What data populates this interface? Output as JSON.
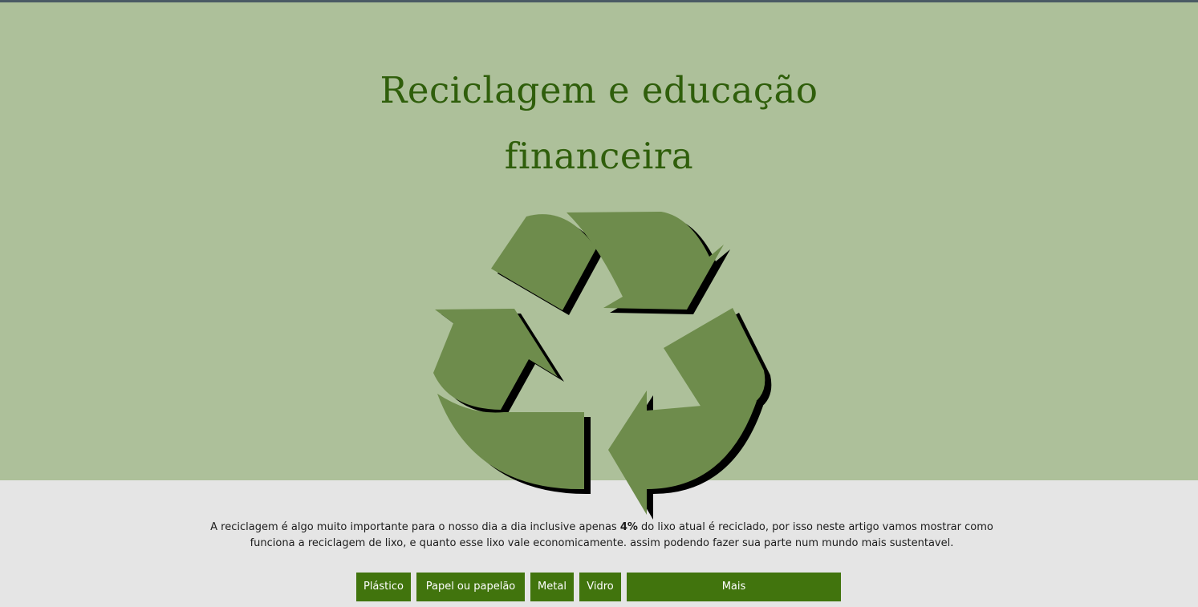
{
  "header": {
    "title_line1": "Reciclagem e educação",
    "title_line2": "financeira"
  },
  "logo": {
    "icon": "recycle-icon",
    "color": "#6e8c4c",
    "shadow": "#000000"
  },
  "intro": {
    "before": "A reciclagem é algo muito importante para o nosso dia a dia inclusive apenas ",
    "highlight": "4%",
    "after": " do lixo atual é reciclado, por isso neste artigo vamos mostrar como funciona a reciclagem de lixo, e quanto esse lixo vale economicamente. assim podendo fazer sua parte num mundo mais sustentavel."
  },
  "menu": {
    "items": [
      {
        "label": "Plástico"
      },
      {
        "label": "Papel ou papelão"
      },
      {
        "label": "Metal"
      },
      {
        "label": "Vidro"
      },
      {
        "label": "Mais"
      }
    ]
  },
  "colors": {
    "hero_bg": "#adc09a",
    "title": "#2f5e0b",
    "button_bg": "#41740d",
    "page_bg": "#e5e5e5"
  }
}
